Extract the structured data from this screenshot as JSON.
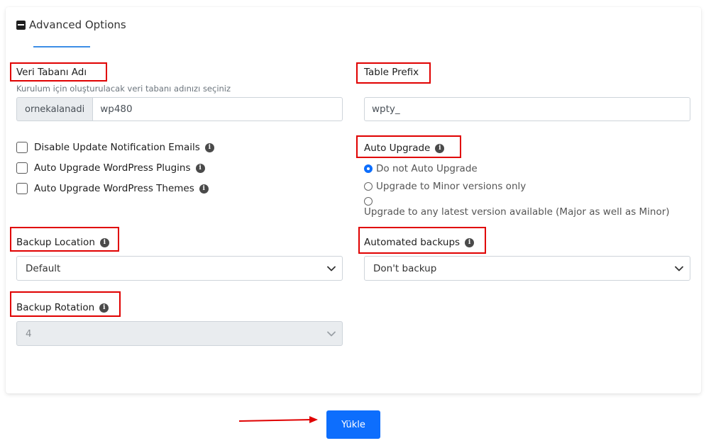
{
  "advanced": {
    "title": "Advanced Options",
    "db_name": {
      "label": "Veri Tabanı Adı",
      "help": "Kurulum için oluşturulacak veri tabanı adınızı seçiniz",
      "prefix": "ornekalanadi",
      "value": "wp480"
    },
    "table_prefix": {
      "label": "Table Prefix",
      "value": "wpty_"
    },
    "checkboxes": [
      {
        "label": "Disable Update Notification Emails",
        "checked": false
      },
      {
        "label": "Auto Upgrade WordPress Plugins",
        "checked": false
      },
      {
        "label": "Auto Upgrade WordPress Themes",
        "checked": false
      }
    ],
    "auto_upgrade": {
      "label": "Auto Upgrade",
      "options": [
        "Do not Auto Upgrade",
        "Upgrade to Minor versions only",
        "Upgrade to any latest version available (Major as well as Minor)"
      ],
      "selected": 0
    },
    "backup_location": {
      "label": "Backup Location",
      "value": "Default"
    },
    "automated_backups": {
      "label": "Automated backups",
      "value": "Don't backup"
    },
    "backup_rotation": {
      "label": "Backup Rotation",
      "value": "4",
      "disabled": true
    }
  },
  "submit": {
    "label": "Yükle"
  },
  "colors": {
    "highlight": "#e00000",
    "primary": "#0d6efd",
    "tab_underline": "#3d8ee6"
  }
}
